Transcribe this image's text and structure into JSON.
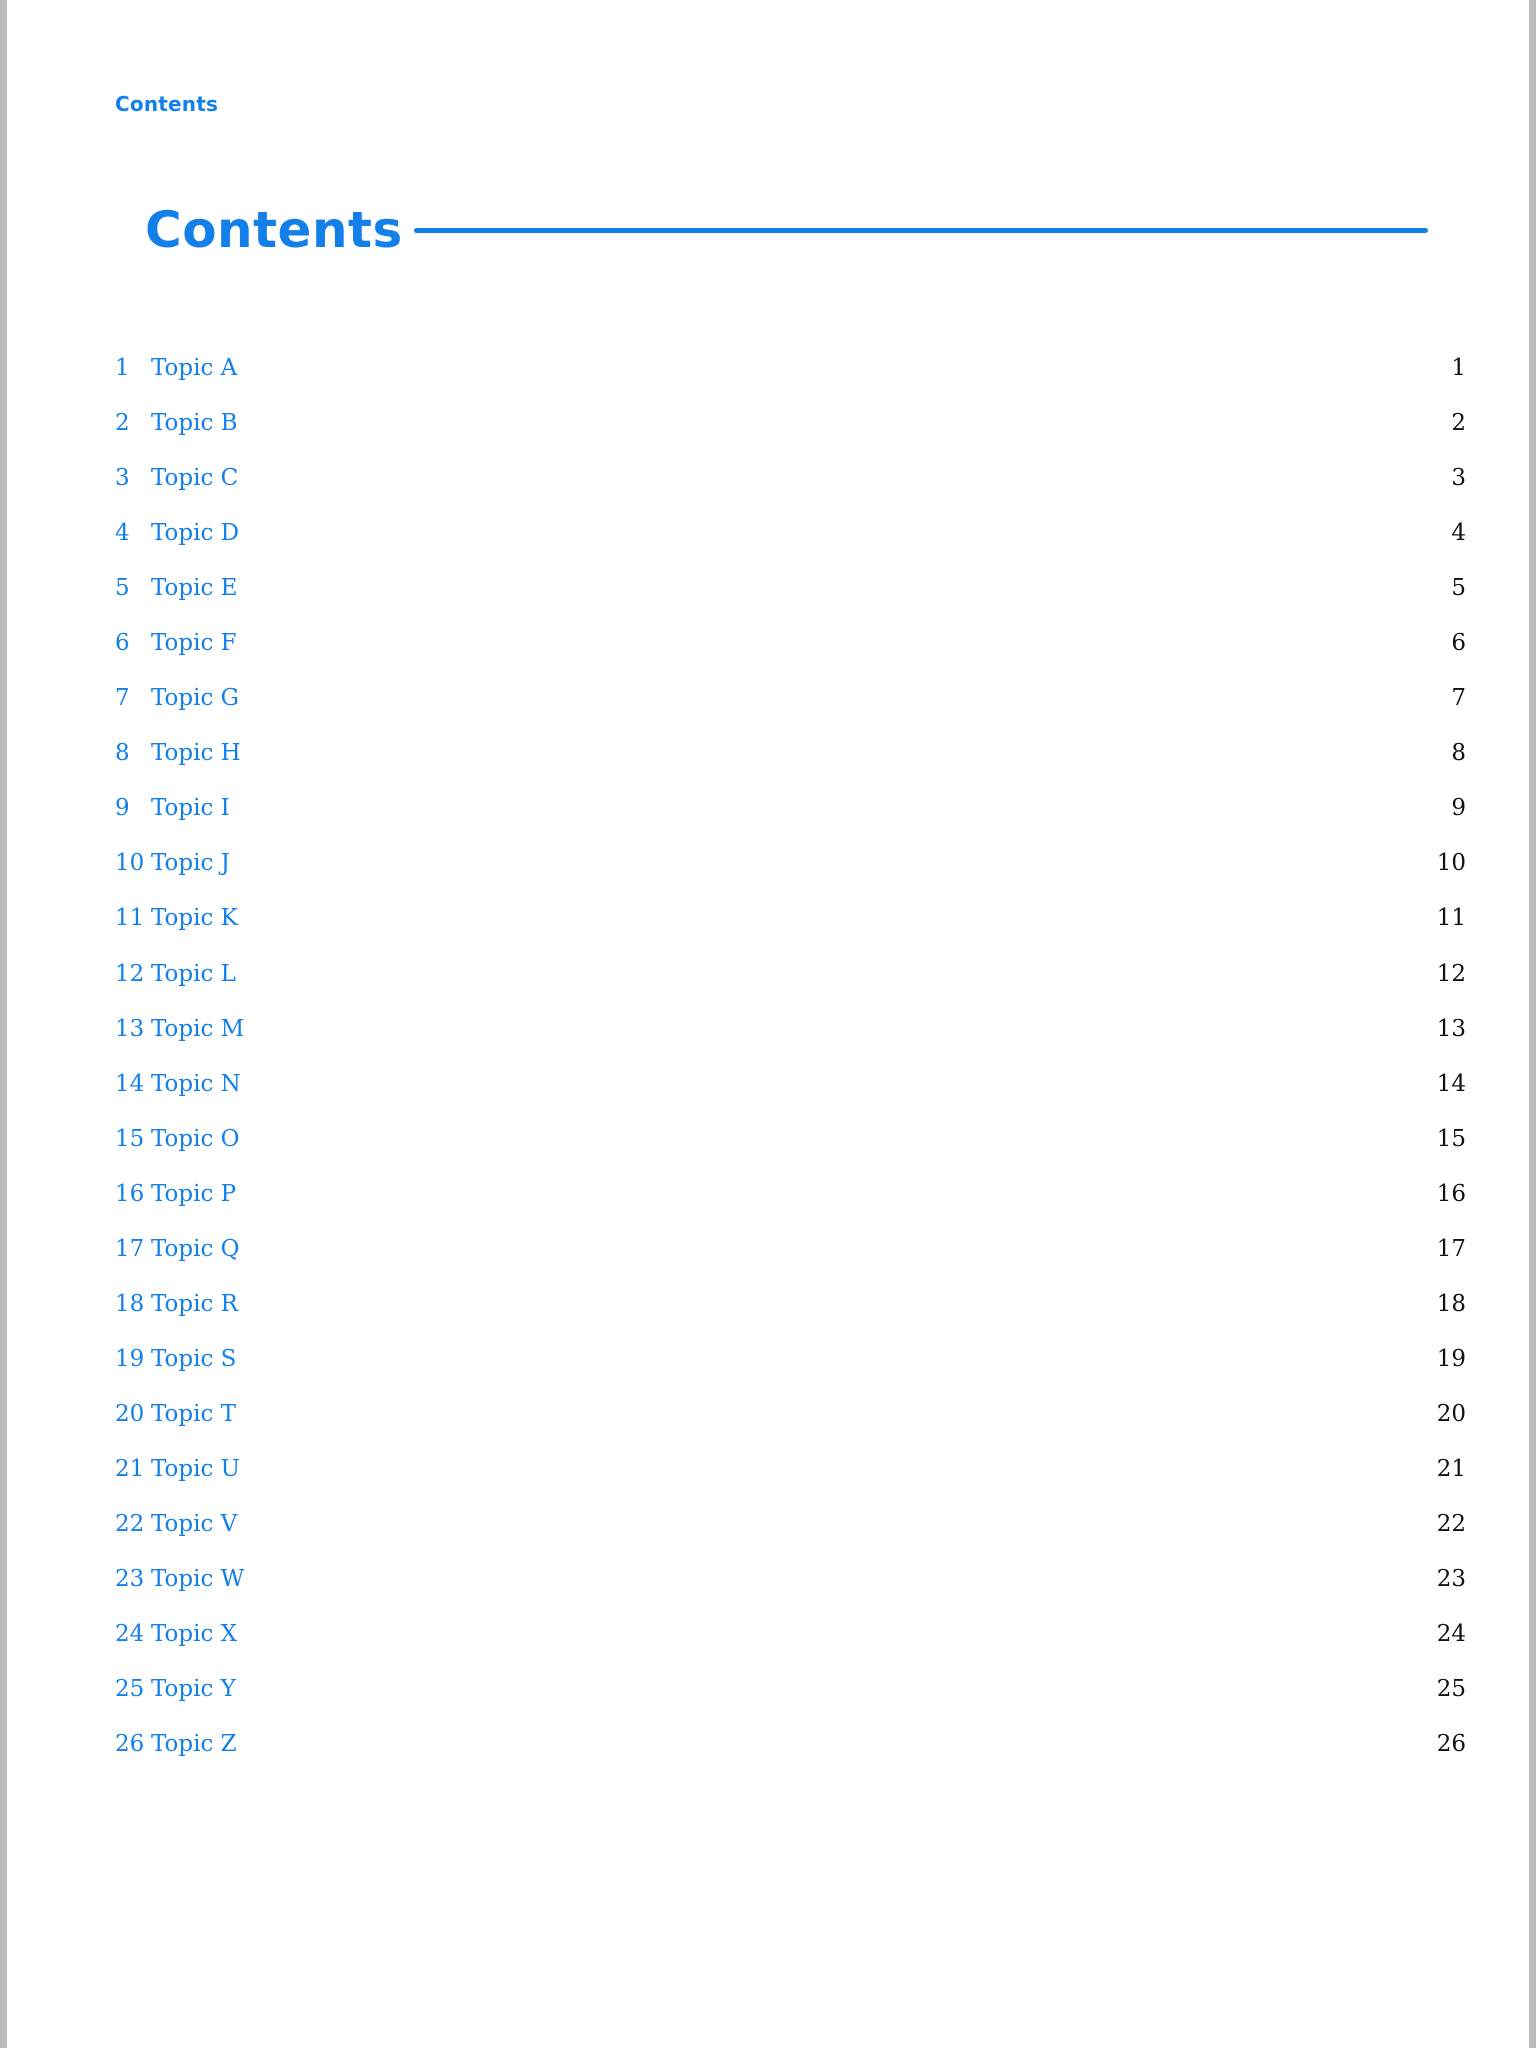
{
  "header": {
    "running_title": "Contents"
  },
  "main": {
    "title": "Contents",
    "entries": [
      {
        "number": "1",
        "label": "Topic A",
        "page": "1"
      },
      {
        "number": "2",
        "label": "Topic B",
        "page": "2"
      },
      {
        "number": "3",
        "label": "Topic C",
        "page": "3"
      },
      {
        "number": "4",
        "label": "Topic D",
        "page": "4"
      },
      {
        "number": "5",
        "label": "Topic E",
        "page": "5"
      },
      {
        "number": "6",
        "label": "Topic F",
        "page": "6"
      },
      {
        "number": "7",
        "label": "Topic G",
        "page": "7"
      },
      {
        "number": "8",
        "label": "Topic H",
        "page": "8"
      },
      {
        "number": "9",
        "label": "Topic I",
        "page": "9"
      },
      {
        "number": "10",
        "label": "Topic J",
        "page": "10"
      },
      {
        "number": "11",
        "label": "Topic K",
        "page": "11"
      },
      {
        "number": "12",
        "label": "Topic L",
        "page": "12"
      },
      {
        "number": "13",
        "label": "Topic M",
        "page": "13"
      },
      {
        "number": "14",
        "label": "Topic N",
        "page": "14"
      },
      {
        "number": "15",
        "label": "Topic O",
        "page": "15"
      },
      {
        "number": "16",
        "label": "Topic P",
        "page": "16"
      },
      {
        "number": "17",
        "label": "Topic Q",
        "page": "17"
      },
      {
        "number": "18",
        "label": "Topic R",
        "page": "18"
      },
      {
        "number": "19",
        "label": "Topic S",
        "page": "19"
      },
      {
        "number": "20",
        "label": "Topic T",
        "page": "20"
      },
      {
        "number": "21",
        "label": "Topic U",
        "page": "21"
      },
      {
        "number": "22",
        "label": "Topic V",
        "page": "22"
      },
      {
        "number": "23",
        "label": "Topic W",
        "page": "23"
      },
      {
        "number": "24",
        "label": "Topic X",
        "page": "24"
      },
      {
        "number": "25",
        "label": "Topic Y",
        "page": "25"
      },
      {
        "number": "26",
        "label": "Topic Z",
        "page": "26"
      }
    ]
  },
  "colors": {
    "accent": "#1380ea",
    "page_number": "#111111",
    "background": "#ffffff",
    "margin": "#bdbdbd"
  }
}
